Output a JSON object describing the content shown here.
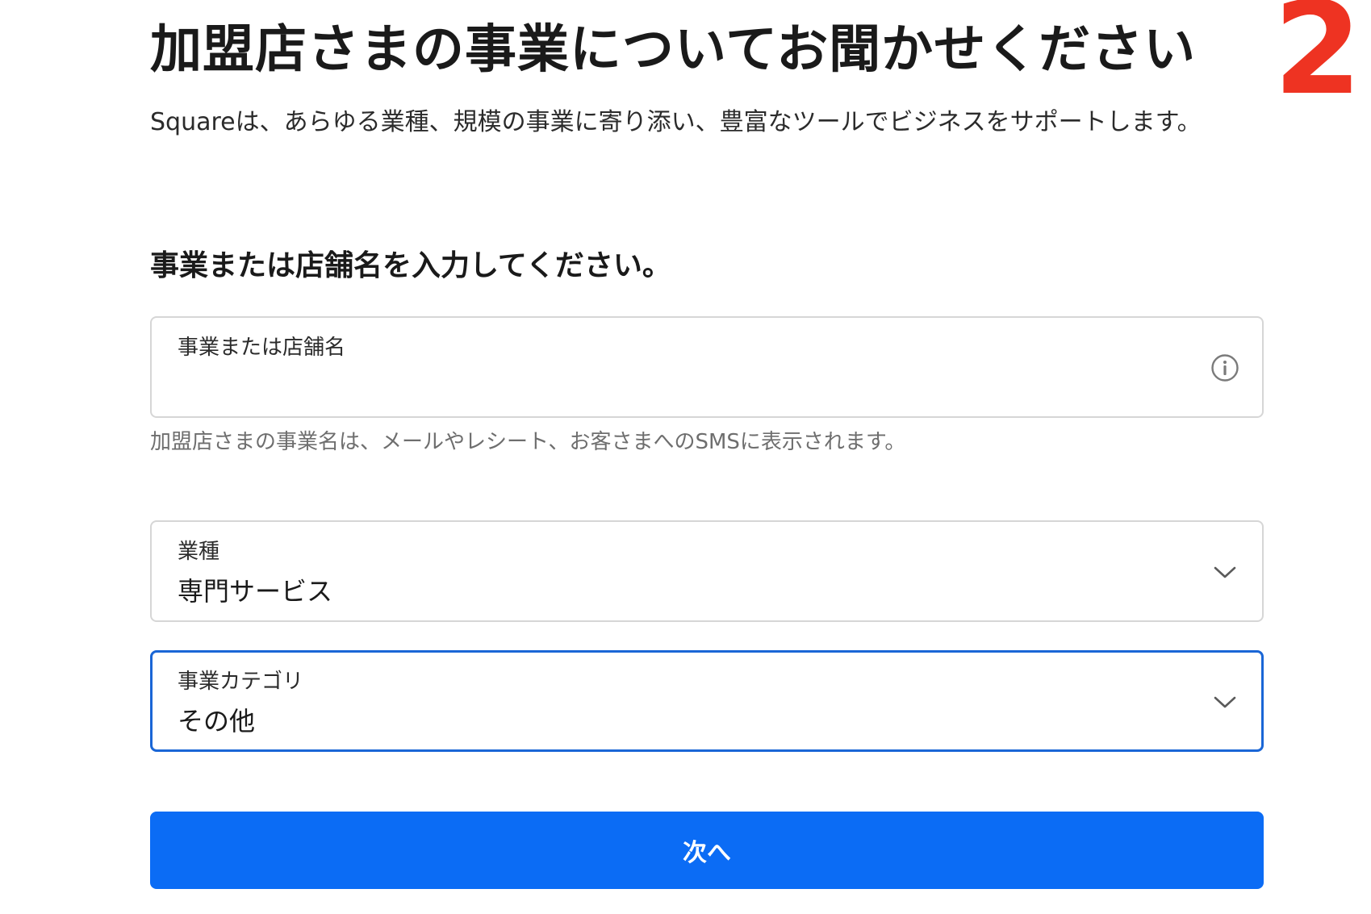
{
  "step_number": "2",
  "page_title": "加盟店さまの事業についてお聞かせください",
  "intro_text": "Squareは、あらゆる業種、規模の事業に寄り添い、豊富なツールでビジネスをサポートします。",
  "section_heading": "事業または店舗名を入力してください。",
  "business_name_field": {
    "label": "事業または店舗名",
    "value": "",
    "icon": "info-icon",
    "helper_text": "加盟店さまの事業名は、メールやレシート、お客さまへのSMSに表示されます。"
  },
  "industry_select": {
    "label": "業種",
    "selected_value": "専門サービス",
    "icon": "chevron-down-icon"
  },
  "category_select": {
    "label": "事業カテゴリ",
    "selected_value": "その他",
    "icon": "chevron-down-icon",
    "focused": true
  },
  "next_button": {
    "label": "次へ"
  },
  "colors": {
    "step_number": "#ee3322",
    "focus_border": "#1a66d6",
    "primary_button": "#0b6cf5",
    "border": "#d6d6d6",
    "helper_text": "#6e6e6e"
  }
}
